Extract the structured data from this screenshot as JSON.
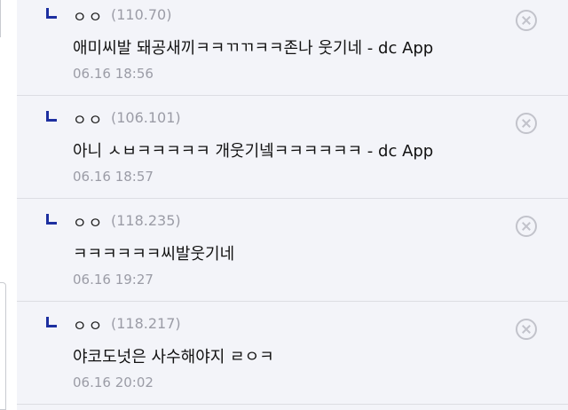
{
  "replies": [
    {
      "nickname": "ㅇㅇ",
      "ip": "(110.70)",
      "message": "애미씨발 돼공새끼ㅋㅋㄲㄲㅋㅋ존나 웃기네 - dc App",
      "time": "06.16 18:56"
    },
    {
      "nickname": "ㅇㅇ",
      "ip": "(106.101)",
      "message": "아니 ㅅㅂㅋㅋㅋㅋㅋ 개웃기넼ㅋㅋㅋㅋㅋㅋ - dc App",
      "time": "06.16 18:57"
    },
    {
      "nickname": "ㅇㅇ",
      "ip": "(118.235)",
      "message": "ㅋㅋㅋㅋㅋㅋ씨발웃기네",
      "time": "06.16 19:27"
    },
    {
      "nickname": "ㅇㅇ",
      "ip": "(118.217)",
      "message": "야코도넛은 사수해야지 ㄹㅇㅋ",
      "time": "06.16 20:02"
    }
  ],
  "icons": {
    "reply_marker": "reply-arrow-icon",
    "delete": "close-circle-icon"
  },
  "colors": {
    "panel_bg": "#f3f4f9",
    "reply_marker": "#1d2fa0",
    "meta_text": "#9b9ca6"
  }
}
